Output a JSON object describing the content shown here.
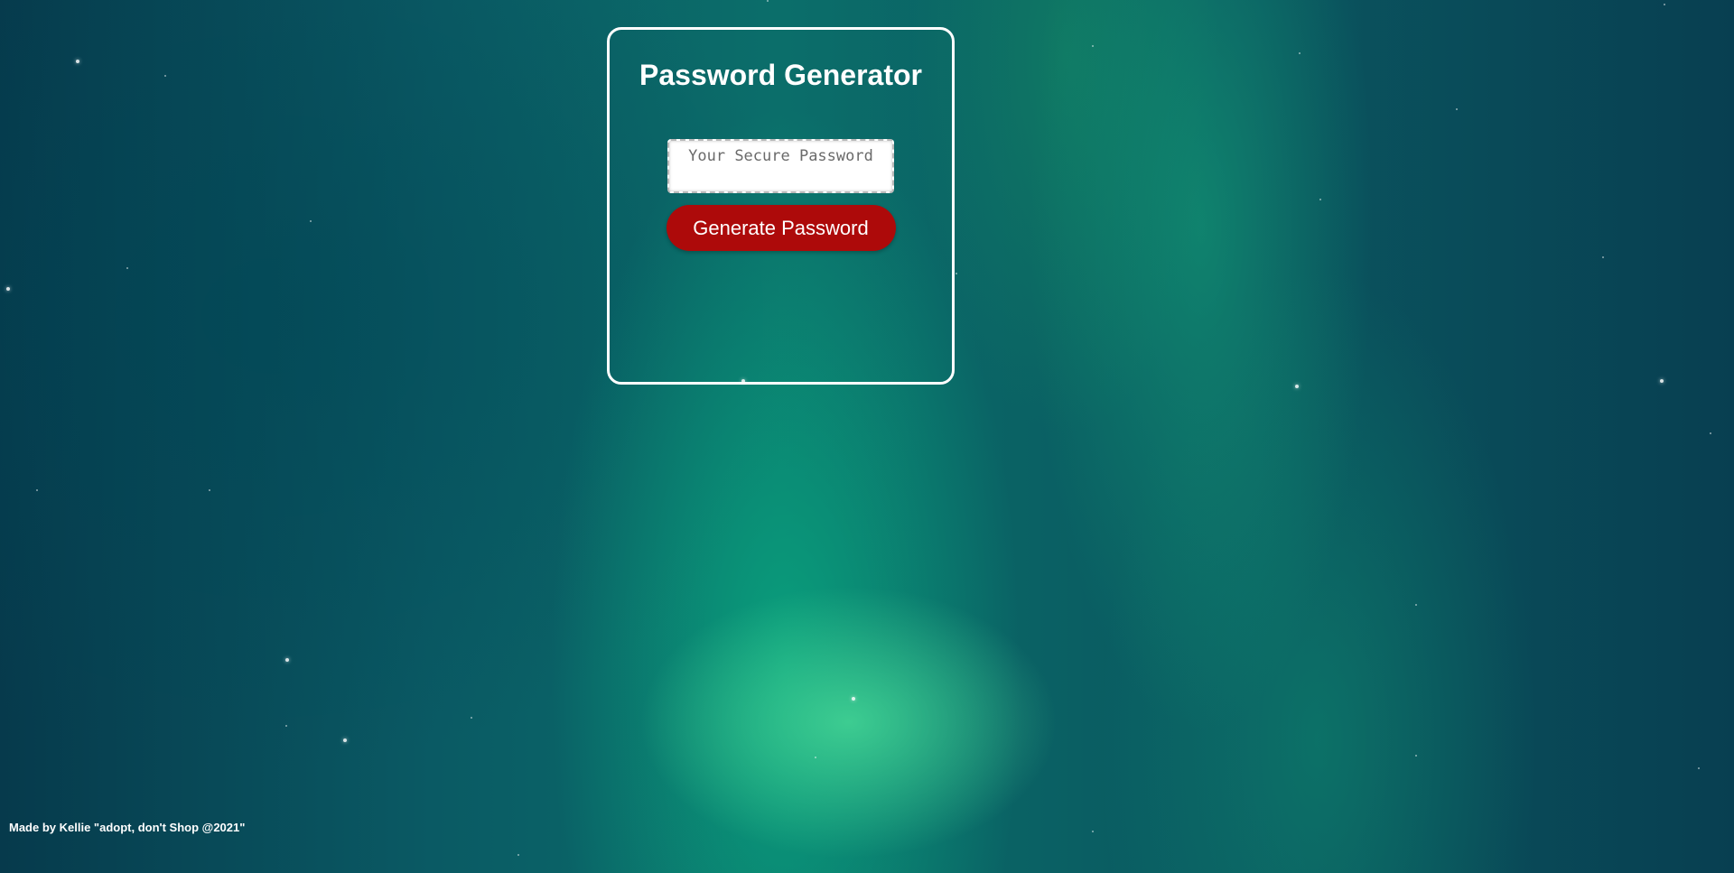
{
  "card": {
    "title": "Password Generator",
    "password_placeholder": "Your Secure Password",
    "password_value": "",
    "generate_label": "Generate Password"
  },
  "footer": {
    "text": "Made by Kellie \"adopt, don't Shop @2021\""
  },
  "colors": {
    "button": "#ad0a0a",
    "card_border": "#ffffff",
    "title_text": "#ffffff"
  }
}
